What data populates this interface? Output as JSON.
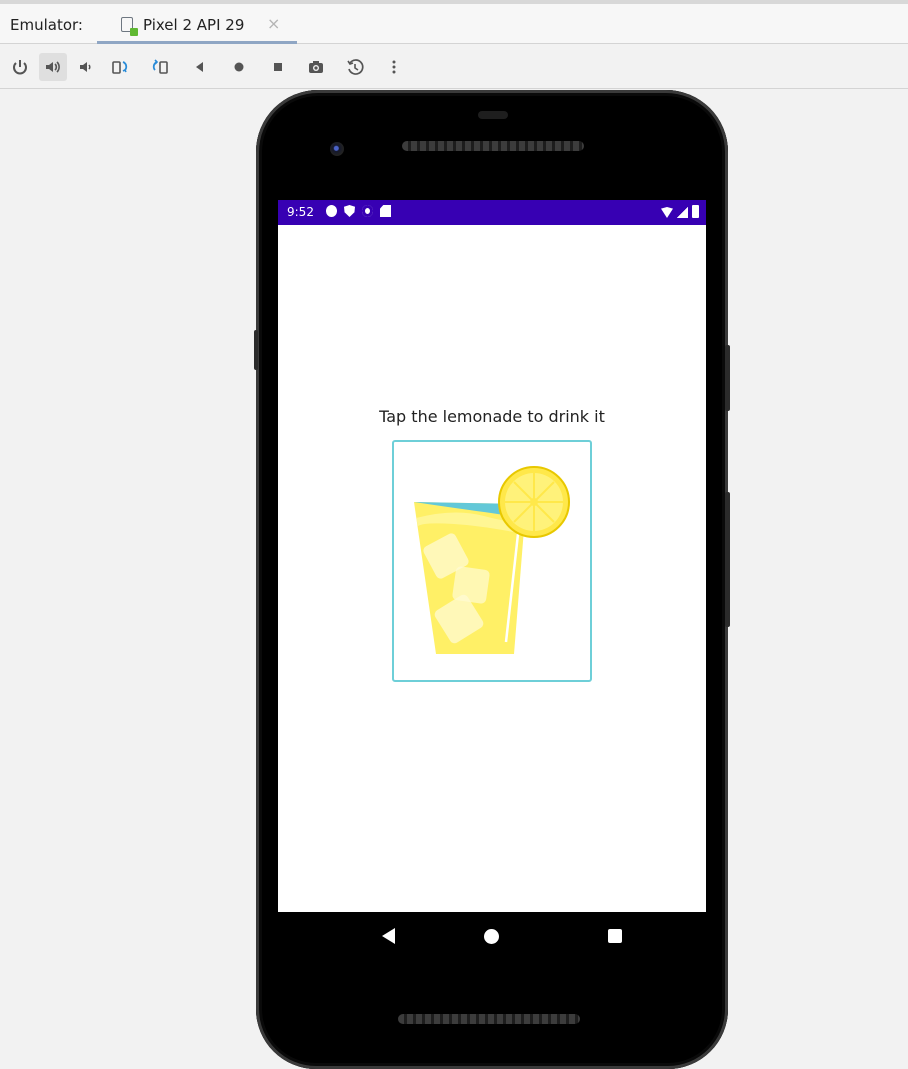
{
  "tabbar": {
    "label": "Emulator:",
    "tab_title": "Pixel 2 API 29",
    "close_glyph": "×"
  },
  "toolbar": {
    "icons": [
      "power-icon",
      "volume-up-icon",
      "volume-down-icon",
      "rotate-left-icon",
      "rotate-right-icon",
      "back-icon",
      "home-icon",
      "overview-icon",
      "screenshot-icon",
      "snapshot-icon",
      "more-icon"
    ]
  },
  "status": {
    "time": "9:52",
    "bar_color": "#3700b3"
  },
  "app": {
    "instruction": "Tap the lemonade to drink it",
    "image_border_color": "#6ecfd8"
  },
  "colors": {
    "lemonade": "#fff066",
    "water": "#63c8d8",
    "lemon": "#ffe84a"
  }
}
